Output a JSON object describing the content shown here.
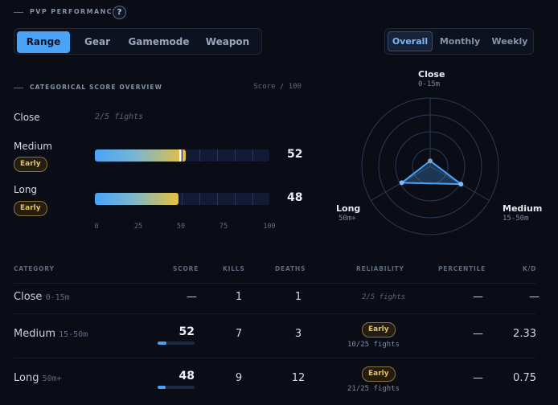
{
  "header": {
    "title": "PVP PERFORMANCE",
    "help": "?"
  },
  "tabs": [
    {
      "label": "Range",
      "active": true
    },
    {
      "label": "Gear",
      "active": false
    },
    {
      "label": "Gamemode",
      "active": false
    },
    {
      "label": "Weapon",
      "active": false
    }
  ],
  "period": [
    {
      "label": "Overall",
      "active": true
    },
    {
      "label": "Monthly",
      "active": false
    },
    {
      "label": "Weekly",
      "active": false
    }
  ],
  "overview": {
    "title": "CATEGORICAL SCORE OVERVIEW",
    "scale": "Score / 100",
    "rows": [
      {
        "label": "Close",
        "note": "2/5 fights"
      },
      {
        "label": "Medium",
        "badge": "Early",
        "value": "52",
        "score": 52
      },
      {
        "label": "Long",
        "badge": "Early",
        "value": "48",
        "score": 48
      }
    ],
    "ticks": [
      "0",
      "25",
      "50",
      "75",
      "100"
    ]
  },
  "radar": {
    "close": {
      "label": "Close",
      "sub": "0-15m",
      "score": 0
    },
    "medium": {
      "label": "Medium",
      "sub": "15-50m",
      "score": 52
    },
    "long": {
      "label": "Long",
      "sub": "50m+",
      "score": 48
    }
  },
  "table": {
    "headers": {
      "category": "CATEGORY",
      "score": "SCORE",
      "kills": "KILLS",
      "deaths": "DEATHS",
      "reliability": "RELIABILITY",
      "percentile": "PERCENTILE",
      "kd": "K/D"
    },
    "rows": [
      {
        "name": "Close",
        "range": "0-15m",
        "score": "—",
        "kills": "1",
        "deaths": "1",
        "reliability_note": "2/5 fights",
        "percentile": "—",
        "kd": "—"
      },
      {
        "name": "Medium",
        "range": "15-50m",
        "score": "52",
        "score_value": 52,
        "kills": "7",
        "deaths": "3",
        "badge": "Early",
        "fights": "10/25 fights",
        "percentile": "—",
        "kd": "2.33"
      },
      {
        "name": "Long",
        "range": "50m+",
        "score": "48",
        "score_value": 48,
        "kills": "9",
        "deaths": "12",
        "badge": "Early",
        "fights": "21/25 fights",
        "percentile": "—",
        "kd": "0.75"
      }
    ]
  },
  "colors": {
    "accent": "#4aa3f7",
    "gold": "#e8c13a",
    "background": "#0a0d16"
  }
}
